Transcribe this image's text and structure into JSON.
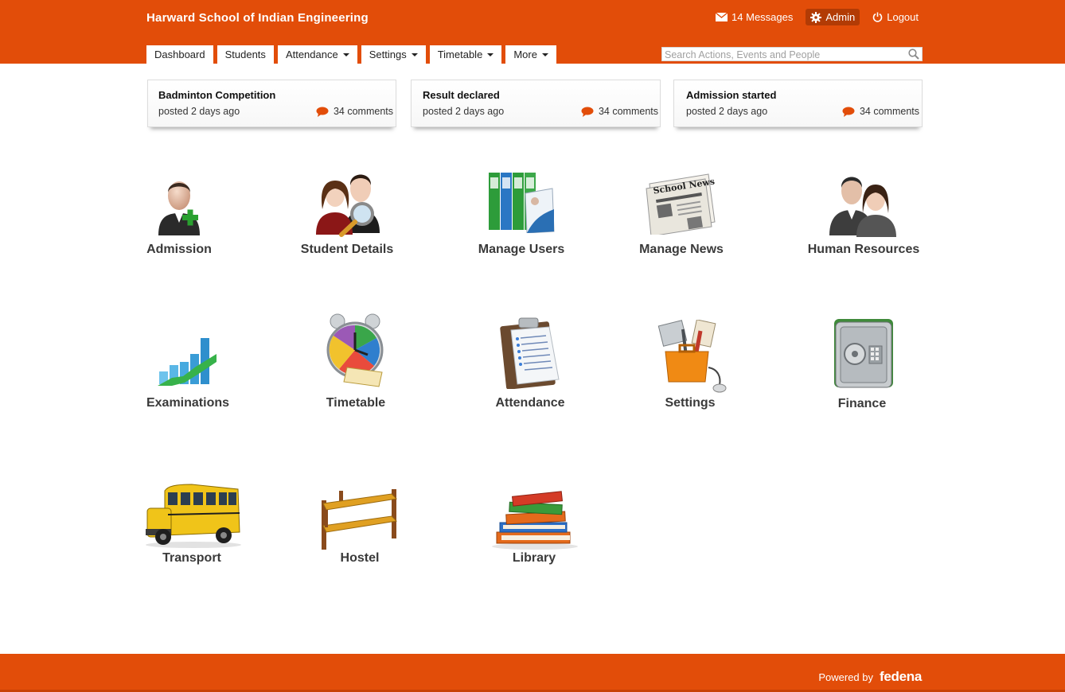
{
  "header": {
    "school_name": "Harward School of Indian Engineering",
    "messages_label": "14 Messages",
    "admin_label": "Admin",
    "logout_label": "Logout",
    "brand_color": "#e24d09"
  },
  "nav": {
    "tabs": [
      {
        "label": "Dashboard",
        "has_dropdown": false
      },
      {
        "label": "Students",
        "has_dropdown": false
      },
      {
        "label": "Attendance",
        "has_dropdown": true
      },
      {
        "label": "Settings",
        "has_dropdown": true
      },
      {
        "label": "Timetable",
        "has_dropdown": true
      },
      {
        "label": "More",
        "has_dropdown": true
      }
    ],
    "search_placeholder": "Search Actions, Events and People"
  },
  "news": [
    {
      "title": "Badminton Competition",
      "posted": "posted 2 days ago",
      "comments": "34 comments"
    },
    {
      "title": "Result declared",
      "posted": "posted 2 days ago",
      "comments": "34 comments"
    },
    {
      "title": "Admission started",
      "posted": "posted 2 days ago",
      "comments": "34 comments"
    }
  ],
  "modules": [
    {
      "label": "Admission",
      "icon": "admission-icon"
    },
    {
      "label": "Student Details",
      "icon": "student-details-icon"
    },
    {
      "label": "Manage Users",
      "icon": "manage-users-icon"
    },
    {
      "label": "Manage News",
      "icon": "newspaper-icon"
    },
    {
      "label": "Human Resources",
      "icon": "human-resources-icon"
    },
    {
      "label": "Examinations",
      "icon": "chart-icon"
    },
    {
      "label": "Timetable",
      "icon": "alarm-clock-icon"
    },
    {
      "label": "Attendance",
      "icon": "clipboard-icon"
    },
    {
      "label": "Settings",
      "icon": "toolbox-icon"
    },
    {
      "label": "Finance",
      "icon": "safe-icon"
    },
    {
      "label": "Transport",
      "icon": "school-bus-icon"
    },
    {
      "label": "Hostel",
      "icon": "bunk-bed-icon"
    },
    {
      "label": "Library",
      "icon": "books-icon"
    }
  ],
  "footer": {
    "powered_by": "Powered by",
    "brand": "fedena"
  }
}
